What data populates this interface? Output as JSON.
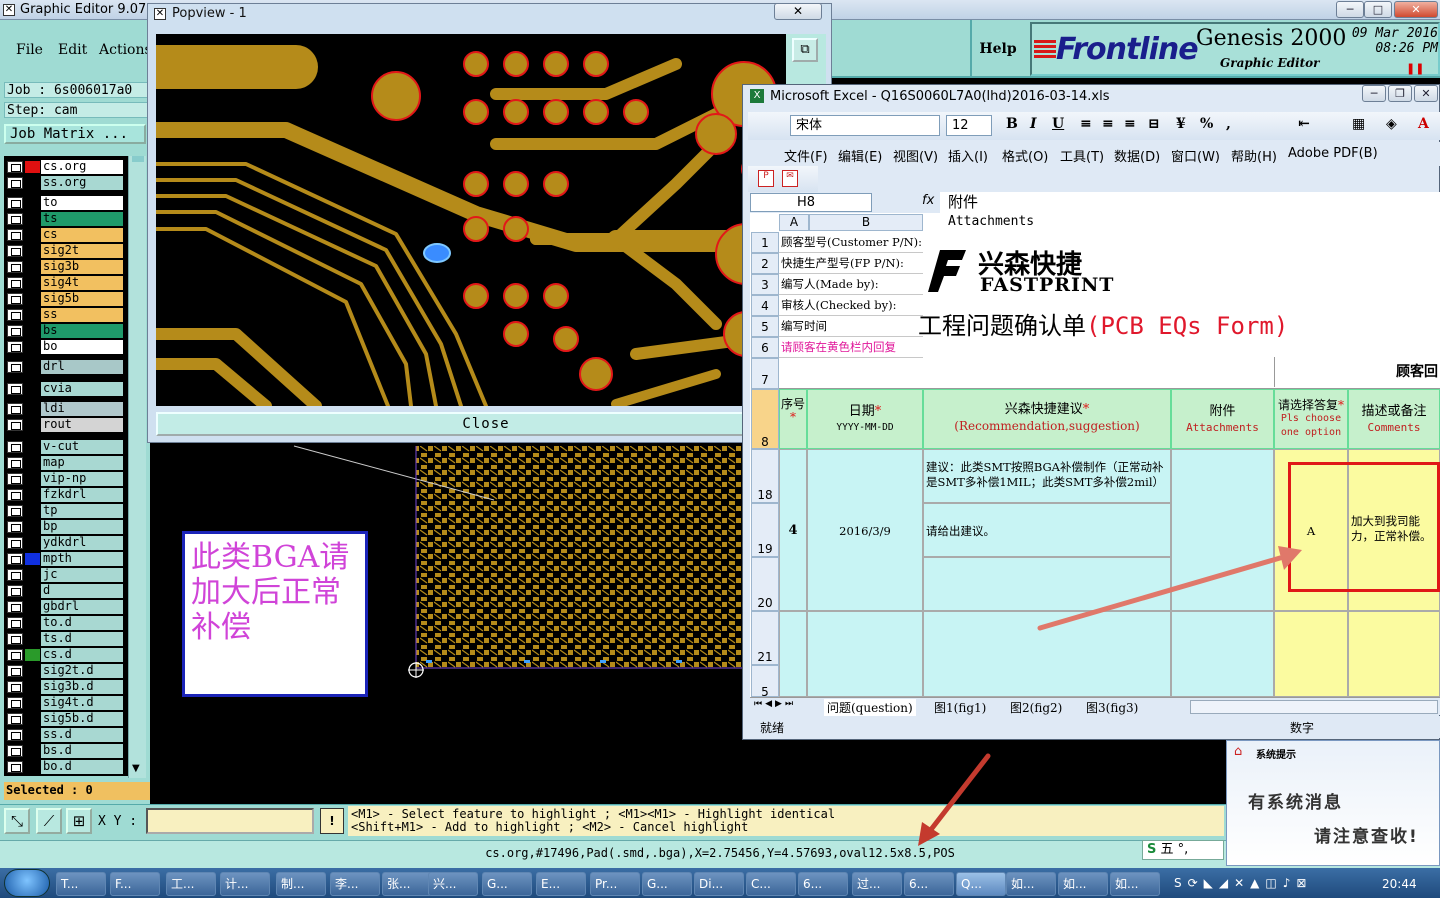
{
  "genesis": {
    "title": "Graphic Editor 9.07b2",
    "menu": [
      "File",
      "Edit",
      "Actions"
    ],
    "help": "Help",
    "logo_text": "Frontline",
    "product": "Genesis 2000",
    "subtitle": "Graphic Editor",
    "date": "09 Mar 2016",
    "time": "08:26 PM",
    "job": "Job : 6s006017a0",
    "step": "Step: cam",
    "job_matrix": "Job Matrix ...",
    "selected": "Selected : 0",
    "xy_label": "X Y :",
    "hint_line1": "<M1> - Select feature to highlight ; <M1><M1> - Highlight identical",
    "hint_line2": "<Shift+M1> - Add to highlight ; <M2> - Cancel highlight",
    "status": "cs.org,#17496,Pad(.smd,.bga),X=2.75456,Y=4.57693,oval12.5x8.5,POS",
    "note": "此类BGA请加大后正常补偿",
    "layers": [
      {
        "name": "cs.org",
        "color": "#ffffff",
        "swatch": "#e01010"
      },
      {
        "name": "ss.org",
        "color": "#a8d8d2",
        "swatch": ""
      },
      {
        "name": "to",
        "color": "#ffffff",
        "swatch": ""
      },
      {
        "name": "ts",
        "color": "#1f9a6a",
        "swatch": ""
      },
      {
        "name": "cs",
        "color": "#f2c060",
        "swatch": ""
      },
      {
        "name": "sig2t",
        "color": "#f2c060",
        "swatch": ""
      },
      {
        "name": "sig3b",
        "color": "#f2c060",
        "swatch": ""
      },
      {
        "name": "sig4t",
        "color": "#f2c060",
        "swatch": ""
      },
      {
        "name": "sig5b",
        "color": "#f2c060",
        "swatch": ""
      },
      {
        "name": "ss",
        "color": "#f2c060",
        "swatch": ""
      },
      {
        "name": "bs",
        "color": "#1f9a6a",
        "swatch": ""
      },
      {
        "name": "bo",
        "color": "#ffffff",
        "swatch": ""
      },
      {
        "name": "drl",
        "color": "#a8c8c8",
        "swatch": ""
      },
      {
        "name": "cvia",
        "color": "#a8d8d2",
        "swatch": ""
      },
      {
        "name": "ldi",
        "color": "#b0c8cc",
        "swatch": ""
      },
      {
        "name": "rout",
        "color": "#d4d4d4",
        "swatch": ""
      },
      {
        "name": "v-cut",
        "color": "#a8d8d2",
        "swatch": ""
      },
      {
        "name": "map",
        "color": "#a8d8d2",
        "swatch": ""
      },
      {
        "name": "vip-np",
        "color": "#a8d8d2",
        "swatch": ""
      },
      {
        "name": "fzkdrl",
        "color": "#a8d8d2",
        "swatch": ""
      },
      {
        "name": "tp",
        "color": "#a8d8d2",
        "swatch": ""
      },
      {
        "name": "bp",
        "color": "#a8d8d2",
        "swatch": ""
      },
      {
        "name": "ydkdrl",
        "color": "#a8d8d2",
        "swatch": ""
      },
      {
        "name": "mpth",
        "color": "#a8d8d2",
        "swatch": "#1030e0"
      },
      {
        "name": "jc",
        "color": "#a8d8d2",
        "swatch": ""
      },
      {
        "name": "d",
        "color": "#a8d8d2",
        "swatch": ""
      },
      {
        "name": "gbdrl",
        "color": "#a8d8d2",
        "swatch": ""
      },
      {
        "name": "to.d",
        "color": "#a8d8d2",
        "swatch": ""
      },
      {
        "name": "ts.d",
        "color": "#a8d8d2",
        "swatch": ""
      },
      {
        "name": "cs.d",
        "color": "#a8d8d2",
        "swatch": "#2a9a2a"
      },
      {
        "name": "sig2t.d",
        "color": "#a8d8d2",
        "swatch": ""
      },
      {
        "name": "sig3b.d",
        "color": "#a8d8d2",
        "swatch": ""
      },
      {
        "name": "sig4t.d",
        "color": "#a8d8d2",
        "swatch": ""
      },
      {
        "name": "sig5b.d",
        "color": "#a8d8d2",
        "swatch": ""
      },
      {
        "name": "ss.d",
        "color": "#a8d8d2",
        "swatch": ""
      },
      {
        "name": "bs.d",
        "color": "#a8d8d2",
        "swatch": ""
      },
      {
        "name": "bo.d",
        "color": "#a8d8d2",
        "swatch": ""
      }
    ]
  },
  "popview": {
    "title": "Popview - 1",
    "close": "Close"
  },
  "excel": {
    "title": "Microsoft Excel - Q16S0060L7A0(lhd)2016-03-14.xls",
    "font": "宋体",
    "size": "12",
    "menu": [
      "文件(F)",
      "编辑(E)",
      "视图(V)",
      "插入(I)",
      "格式(O)",
      "工具(T)",
      "数据(D)",
      "窗口(W)",
      "帮助(H)",
      "Adobe PDF(B)"
    ],
    "namebox": "H8",
    "fx": "fx",
    "formula_line1": "附件",
    "formula_line2": "Attachments",
    "col_a": "A",
    "col_b": "B",
    "rows_top": [
      {
        "num": "1",
        "text": "顾客型号(Customer P/N):"
      },
      {
        "num": "2",
        "text": "快捷生产型号(FP P/N):"
      },
      {
        "num": "3",
        "text": "编写人(Made by):"
      },
      {
        "num": "4",
        "text": "审核人(Checked by):"
      },
      {
        "num": "5",
        "text": "编写时间"
      },
      {
        "num": "6",
        "text": "请顾客在黄色栏内回复"
      }
    ],
    "company_cn": "兴森快捷",
    "company_en": "FASTPRINT",
    "form_title_cn": "工程问题确认单",
    "form_title_en": "(PCB EQs Form)",
    "customer_reply": "顾客回",
    "row7": "7",
    "row8": "8",
    "hdr_seq": "序号",
    "hdr_date": "日期",
    "hdr_date_en": "YYYY-MM-DD",
    "hdr_rec": "兴森快捷建议",
    "hdr_rec_en": "(Recommendation,suggestion)",
    "hdr_att": "附件",
    "hdr_att_en": "Attachments",
    "hdr_choose": "请选择答复",
    "hdr_choose_en": "Pls choose one option",
    "hdr_desc": "描述或备注",
    "hdr_desc_en": "Comments",
    "row_nums": [
      "18",
      "19",
      "20",
      "21",
      "5"
    ],
    "seq": "4",
    "date_val": "2016/3/9",
    "suggestion": "建议：此类SMT按照BGA补偿制作（正常动补是SMT多补偿1MIL；此类SMT多补偿2mil）",
    "request": "请给出建议。",
    "choice": "A",
    "comment": "加大到我司能力，正常补偿。",
    "tabs": [
      "问题(question)",
      "图1(fig1)",
      "图2(fig2)",
      "图3(fig3)"
    ],
    "status_left": "就绪",
    "status_right": "数字"
  },
  "sysnote": {
    "title": "系统提示",
    "line1": "有系统消息",
    "line2": "请注意查收!"
  },
  "ime": "五",
  "taskbar": {
    "items": [
      "T...",
      "F...",
      "工...",
      "计...",
      "制...",
      "李...",
      "张...",
      "兴...",
      "G...",
      "E...",
      "Pr...",
      "G...",
      "Di...",
      "C...",
      "6...",
      "过...",
      "6...",
      "Q...",
      "如...",
      "如...",
      "如..."
    ],
    "clock": "20:44"
  }
}
